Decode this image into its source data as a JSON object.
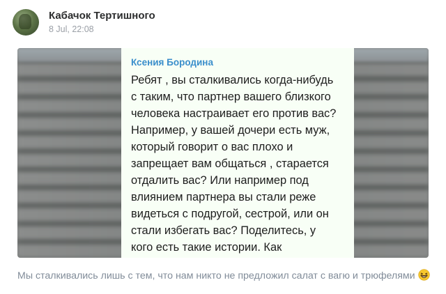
{
  "post": {
    "author": "Кабачок Тертишного",
    "date": "8 Jul, 22:08",
    "caption": "Мы сталкивались лишь с тем, что нам никто не предложил салат с вагю и трюфелями",
    "caption_emoji": "grinning-squinting-face-emoji"
  },
  "image": {
    "sender": "Ксения Бородина",
    "message": "Ребят , вы сталкивались когда-нибудь\nс таким, что партнер вашего близкого\nчеловека настраивает его против вас?\nНапример, у вашей дочери есть муж,\nкоторый говорит о вас плохо и\nзапрещает вам общаться , старается\nотдалить вас? Или например под\nвлиянием партнера вы стали реже\nвидеться с подругой, сестрой, или он\nстали избегать вас? Поделитесь, у\nкого есть такие истории. Как\nсправлялись с таким?"
  },
  "colors": {
    "sender": "#3a8ecb",
    "bubble_bg": "#f8fff6",
    "caption": "#818c99"
  }
}
